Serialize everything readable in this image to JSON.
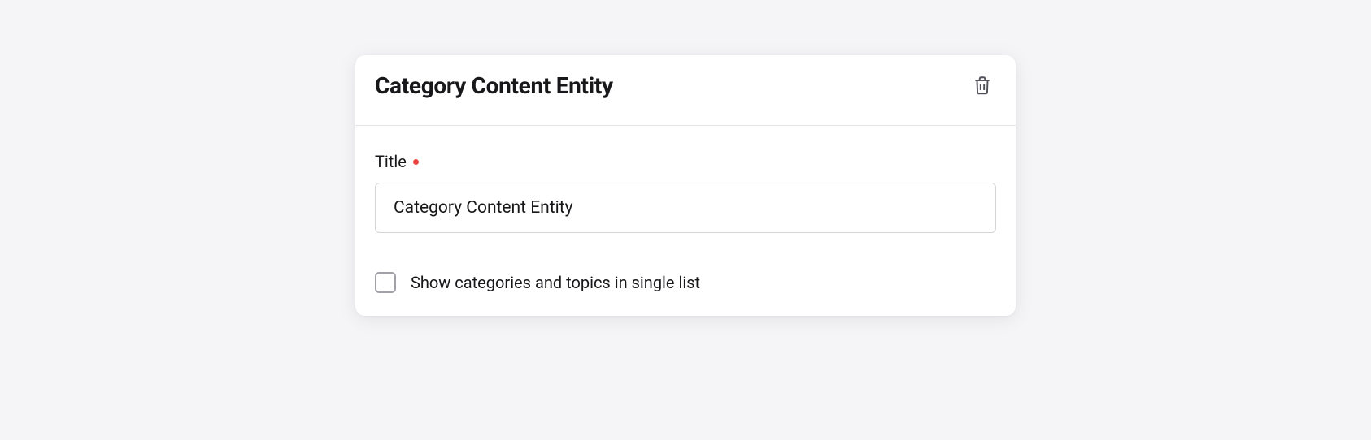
{
  "card": {
    "title": "Category Content Entity",
    "fields": {
      "title": {
        "label": "Title",
        "value": "Category Content Entity",
        "required": true
      },
      "show_single_list": {
        "label": "Show categories and topics in single list",
        "checked": false
      }
    }
  }
}
